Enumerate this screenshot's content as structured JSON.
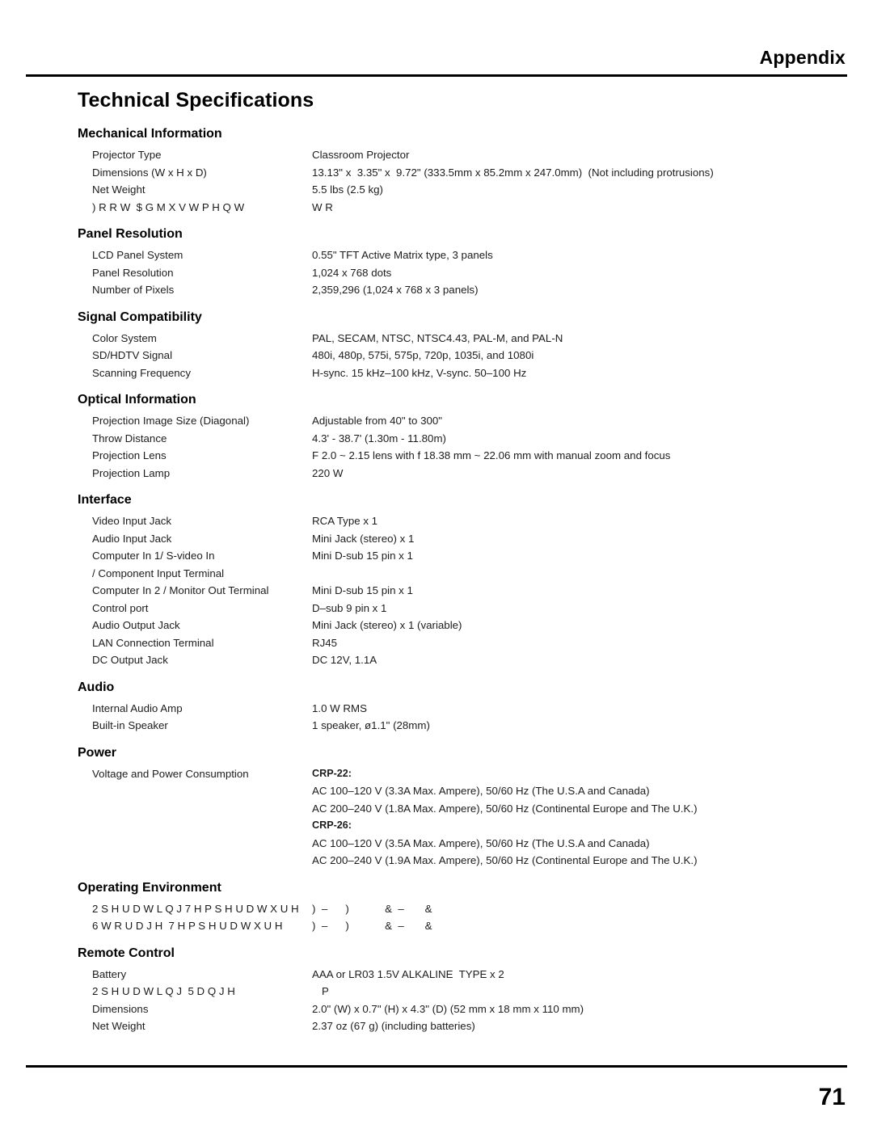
{
  "header": {
    "title": "Appendix"
  },
  "footer": {
    "page_number": "71"
  },
  "doc": {
    "title": "Technical Specifications"
  },
  "sections": [
    {
      "title": "Mechanical Information",
      "rows": [
        {
          "label": "Projector Type",
          "value": "Classroom Projector"
        },
        {
          "label": "Dimensions (W x H x D)",
          "value": "13.13\" x  3.35\" x  9.72\" (333.5mm x 85.2mm x 247.0mm)  (Not including protrusions)"
        },
        {
          "label": "Net Weight",
          "value": "5.5 lbs (2.5 kg)"
        },
        {
          "label": ") R R W  $ G M X V W P H Q W",
          "value": "W R"
        }
      ]
    },
    {
      "title": "Panel Resolution",
      "rows": [
        {
          "label": "LCD Panel System",
          "value": "0.55\" TFT Active Matrix type, 3 panels"
        },
        {
          "label": "Panel Resolution",
          "value": "1,024 x 768 dots"
        },
        {
          "label": "Number of Pixels",
          "value": "2,359,296 (1,024 x 768 x 3 panels)"
        }
      ]
    },
    {
      "title": "Signal Compatibility",
      "rows": [
        {
          "label": "Color System",
          "value": "PAL, SECAM, NTSC, NTSC4.43, PAL-M, and PAL-N"
        },
        {
          "label": "SD/HDTV Signal",
          "value": "480i, 480p, 575i, 575p, 720p, 1035i, and 1080i"
        },
        {
          "label": "Scanning Frequency",
          "value": "H-sync. 15 kHz–100 kHz, V-sync. 50–100 Hz"
        }
      ]
    },
    {
      "title": "Optical Information",
      "rows": [
        {
          "label": "Projection Image Size (Diagonal)",
          "value": "Adjustable from 40\" to 300\""
        },
        {
          "label": "Throw Distance",
          "value": "4.3' - 38.7' (1.30m - 11.80m)"
        },
        {
          "label": "Projection Lens",
          "value": "F 2.0 ~ 2.15 lens with f 18.38 mm ~ 22.06 mm with manual zoom and focus"
        },
        {
          "label": "Projection Lamp",
          "value": "220 W"
        }
      ]
    },
    {
      "title": "Interface",
      "rows": [
        {
          "label": "Video Input Jack",
          "value": "RCA Type x 1"
        },
        {
          "label": "Audio Input Jack",
          "value": "Mini Jack (stereo) x 1"
        },
        {
          "label": "Computer In 1/ S-video In",
          "value": "Mini D-sub 15 pin x 1"
        },
        {
          "label": "/ Component Input Terminal",
          "value": ""
        },
        {
          "label": "Computer In 2 / Monitor Out Terminal",
          "value": "Mini D-sub 15 pin x 1"
        },
        {
          "label": "Control port",
          "value": "D–sub 9 pin x 1"
        },
        {
          "label": "Audio Output Jack",
          "value": "Mini Jack (stereo) x 1 (variable)"
        },
        {
          "label": "LAN Connection Terminal",
          "value": "RJ45"
        },
        {
          "label": "DC Output Jack",
          "value": "DC 12V, 1.1A"
        }
      ]
    },
    {
      "title": "Audio",
      "rows": [
        {
          "label": "Internal Audio Amp",
          "value": "1.0 W RMS"
        },
        {
          "label": "Built-in Speaker",
          "value": "1 speaker, ø1.1\" (28mm)"
        }
      ]
    },
    {
      "title": "Power",
      "rows": [
        {
          "label": "Voltage and Power Consumption",
          "value": "CRP-22:",
          "bold": true
        },
        {
          "label": "",
          "value": "AC 100–120 V (3.3A Max. Ampere), 50/60 Hz (The U.S.A and Canada)"
        },
        {
          "label": "",
          "value": "AC 200–240 V (1.8A Max. Ampere), 50/60 Hz (Continental Europe and The U.K.)"
        },
        {
          "label": "",
          "value": "CRP-26:",
          "bold": true
        },
        {
          "label": "",
          "value": "AC 100–120 V (3.5A Max. Ampere), 50/60 Hz (The U.S.A and Canada)"
        },
        {
          "label": "",
          "value": "AC 200–240 V (1.9A Max. Ampere), 50/60 Hz (Continental Europe and The U.K.)"
        }
      ]
    },
    {
      "title": "Operating Environment",
      "rows": [
        {
          "label": "2 S H U D W L Q J 7 H P S H U D W X U H",
          "value": ")  –      )            &  –       &"
        },
        {
          "label": "6 W R U D J H  7 H P S H U D W X U H",
          "value": ")  –      )            &  –       &"
        }
      ]
    },
    {
      "title": "Remote Control",
      "rows": [
        {
          "label": "Battery",
          "value": "AAA or LR03 1.5V ALKALINE  TYPE x 2"
        },
        {
          "label": "2 S H U D W L Q J  5 D Q J H",
          "value": "P",
          "indent": true
        },
        {
          "label": "Dimensions",
          "value": "2.0\" (W) x 0.7\" (H) x 4.3\" (D) (52 mm x 18 mm x 110 mm)"
        },
        {
          "label": "Net Weight",
          "value": "2.37 oz (67 g) (including batteries)"
        }
      ]
    }
  ]
}
